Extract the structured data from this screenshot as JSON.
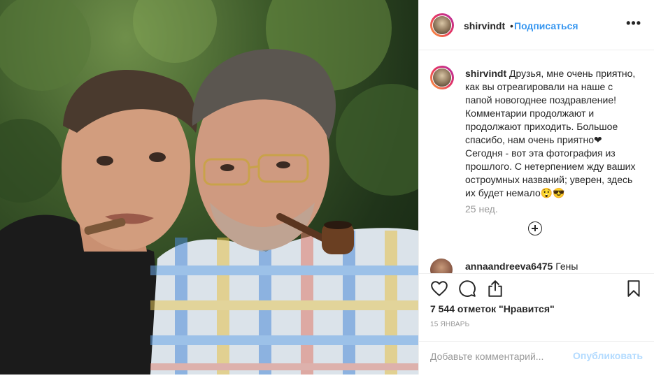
{
  "header": {
    "username": "shirvindt",
    "separator": "•",
    "follow_label": "Подписаться",
    "more_label": "•••"
  },
  "caption": {
    "username": "shirvindt",
    "text": "Друзья, мне очень приятно, как вы отреагировали на наше с папой новогоднее поздравление! Комментарии продолжают и продолжают приходить. Большое спасибо, нам очень приятно❤\nСегодня - вот эта фотография из прошлого. С нетерпением жду ваших остроумных названий; уверен, здесь их будет немало😲😎",
    "time_ago": "25 нед."
  },
  "comment2": {
    "username": "annaandreeva6475",
    "text": "Гены"
  },
  "actions": {
    "likes": "7 544 отметок \"Нравится\"",
    "date": "15 ЯНВАРЬ"
  },
  "add_comment": {
    "placeholder": "Добавьте комментарий...",
    "publish_label": "Опубликовать"
  },
  "icons": {
    "like": "heart-icon",
    "comment": "speech-bubble-icon",
    "share": "share-icon",
    "save": "bookmark-icon",
    "add": "plus-circle-icon",
    "more": "more-dots-icon"
  },
  "colors": {
    "link": "#3897f0",
    "publish_disabled": "#b3dbff",
    "secondary_text": "#999999",
    "border": "#efefef"
  }
}
